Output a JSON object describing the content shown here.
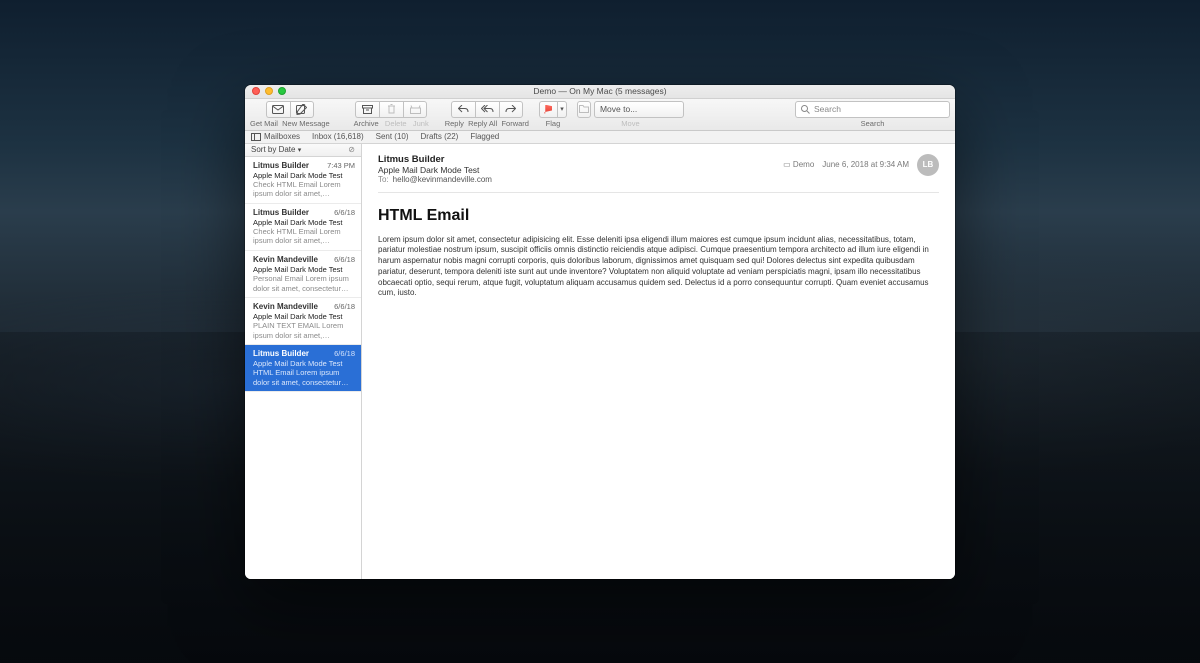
{
  "window": {
    "title": "Demo — On My Mac (5 messages)"
  },
  "toolbar": {
    "get_mail": "Get Mail",
    "new_message": "New Message",
    "archive": "Archive",
    "delete": "Delete",
    "junk": "Junk",
    "reply": "Reply",
    "reply_all": "Reply All",
    "forward": "Forward",
    "flag": "Flag",
    "move_to_placeholder": "Move to...",
    "move": "Move",
    "search_placeholder": "Search",
    "search_label": "Search"
  },
  "favorites": {
    "mailboxes": "Mailboxes",
    "inbox": "Inbox (16,618)",
    "sent": "Sent (10)",
    "drafts": "Drafts (22)",
    "flagged": "Flagged"
  },
  "sort": {
    "label": "Sort by Date"
  },
  "messages": [
    {
      "sender": "Litmus Builder",
      "date": "7:43 PM",
      "subject": "Apple Mail Dark Mode Test",
      "preview": "Check HTML Email Lorem ipsum dolor sit amet, consectetur adipisicing elit..."
    },
    {
      "sender": "Litmus Builder",
      "date": "6/6/18",
      "subject": "Apple Mail Dark Mode Test",
      "preview": "Check HTML Email Lorem ipsum dolor sit amet, consectetur adipisicing elit..."
    },
    {
      "sender": "Kevin Mandeville",
      "date": "6/6/18",
      "subject": "Apple Mail Dark Mode Test",
      "preview": "Personal Email Lorem ipsum dolor sit amet, consectetur adipisicing elit. Ess..."
    },
    {
      "sender": "Kevin Mandeville",
      "date": "6/6/18",
      "subject": "Apple Mail Dark Mode Test",
      "preview": "PLAIN TEXT EMAIL Lorem ipsum dolor sit amet, consectetur adipisicing elit..."
    },
    {
      "sender": "Litmus Builder",
      "date": "6/6/18",
      "subject": "Apple Mail Dark Mode Test",
      "preview": "HTML Email Lorem ipsum dolor sit amet, consectetur adipisicing elit. Ess...",
      "selected": true
    }
  ],
  "reader": {
    "from": "Litmus Builder",
    "subject": "Apple Mail Dark Mode Test",
    "to_label": "To:",
    "to": "hello@kevinmandeville.com",
    "folder": "Demo",
    "timestamp": "June 6, 2018 at 9:34 AM",
    "avatar": "LB",
    "body_heading": "HTML Email",
    "body_text": "Lorem ipsum dolor sit amet, consectetur adipisicing elit. Esse deleniti ipsa eligendi illum maiores est cumque ipsum incidunt alias, necessitatibus, totam, pariatur molestiae nostrum ipsum, suscipit officiis omnis distinctio reiciendis atque adipisci. Cumque praesentium tempora architecto ad illum iure eligendi in harum aspernatur nobis magni corrupti corporis, quis doloribus laborum, dignissimos amet quisquam sed qui! Dolores delectus sint expedita quibusdam pariatur, deserunt, tempora deleniti iste sunt aut unde inventore? Voluptatem non aliquid voluptate ad veniam perspiciatis magni, ipsam illo necessitatibus obcaecati optio, sequi rerum, atque fugit, voluptatum aliquam accusamus quidem sed. Delectus id a porro consequuntur corrupti. Quam eveniet accusamus cum, iusto."
  }
}
